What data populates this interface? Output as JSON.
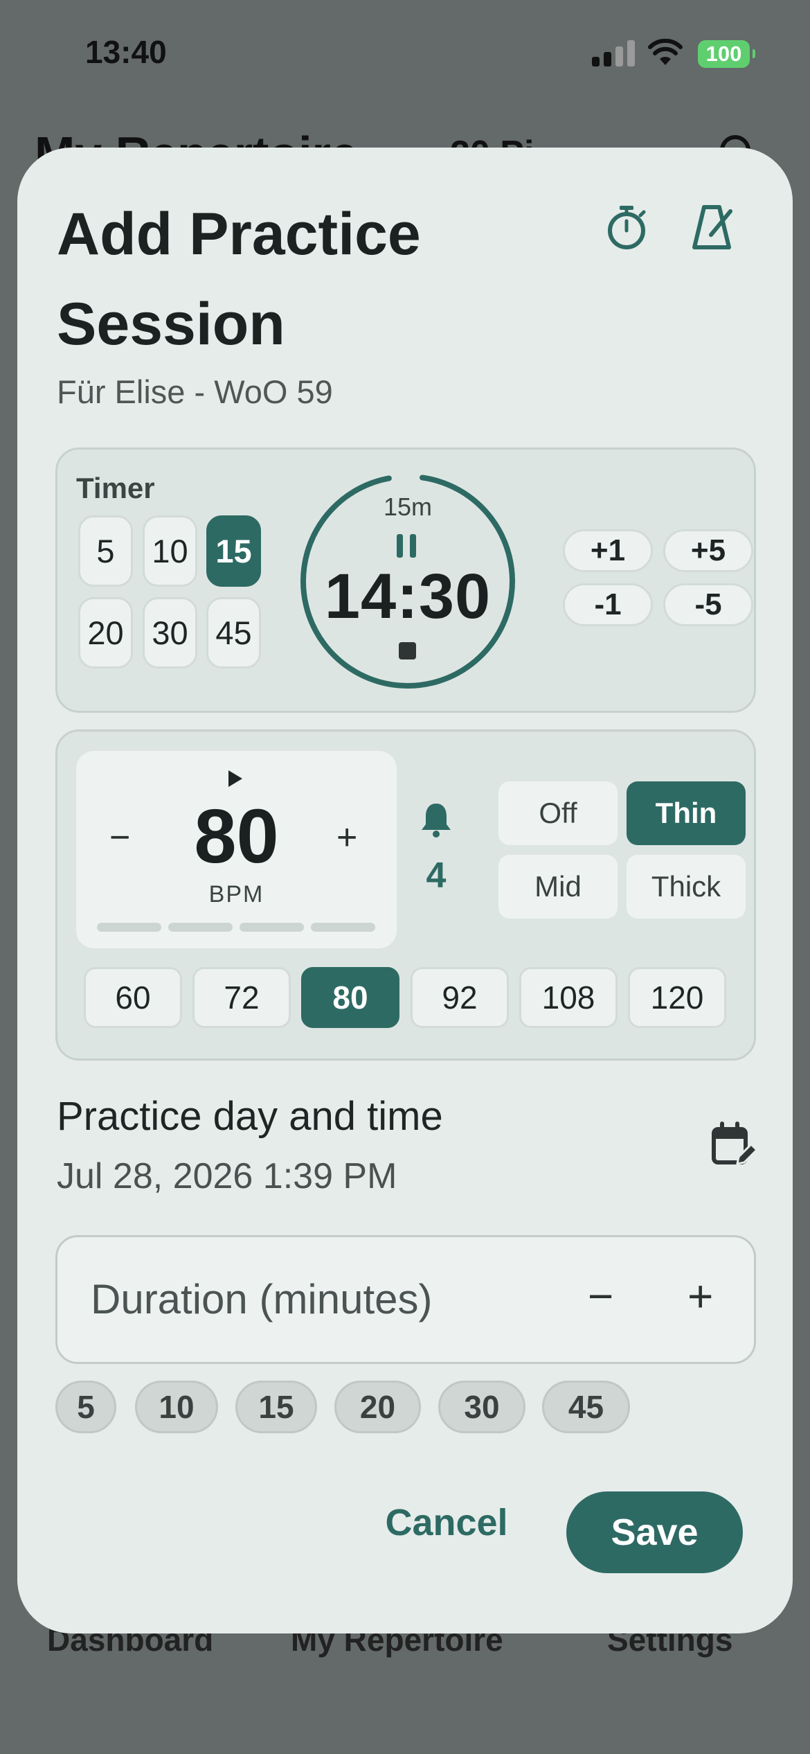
{
  "status_bar": {
    "time": "13:40",
    "battery": "100"
  },
  "background": {
    "page_title": "My Repertoire",
    "pieces_count": "20 Pi",
    "nav": [
      "Dashboard",
      "My Repertoire",
      "Settings"
    ]
  },
  "dialog": {
    "title": "Add Practice Session",
    "subtitle": "Für Elise - WoO 59",
    "timer": {
      "label": "Timer",
      "presets": [
        "5",
        "10",
        "15",
        "20",
        "30",
        "45"
      ],
      "selected_preset": "15",
      "target": "15m",
      "remaining": "14:30",
      "adjust": [
        "+1",
        "+5",
        "-1",
        "-5"
      ]
    },
    "metronome": {
      "minus": "−",
      "plus": "+",
      "bpm": "80",
      "bpm_unit": "BPM",
      "beats": "4",
      "accent_options": [
        "Off",
        "Thin",
        "Mid",
        "Thick"
      ],
      "accent_selected": "Thin",
      "tempo_presets": [
        "60",
        "72",
        "80",
        "92",
        "108",
        "120"
      ],
      "tempo_selected": "80"
    },
    "practice_day": {
      "label": "Practice day and time",
      "value": "Jul 28, 2026 1:39 PM"
    },
    "duration": {
      "placeholder": "Duration (minutes)",
      "minus": "−",
      "plus": "+",
      "chips": [
        "5",
        "10",
        "15",
        "20",
        "30",
        "45"
      ]
    },
    "actions": {
      "cancel": "Cancel",
      "save": "Save"
    }
  },
  "colors": {
    "accent": "#2d6a63",
    "surface": "#e6ecea",
    "scrim": "#636a69"
  }
}
